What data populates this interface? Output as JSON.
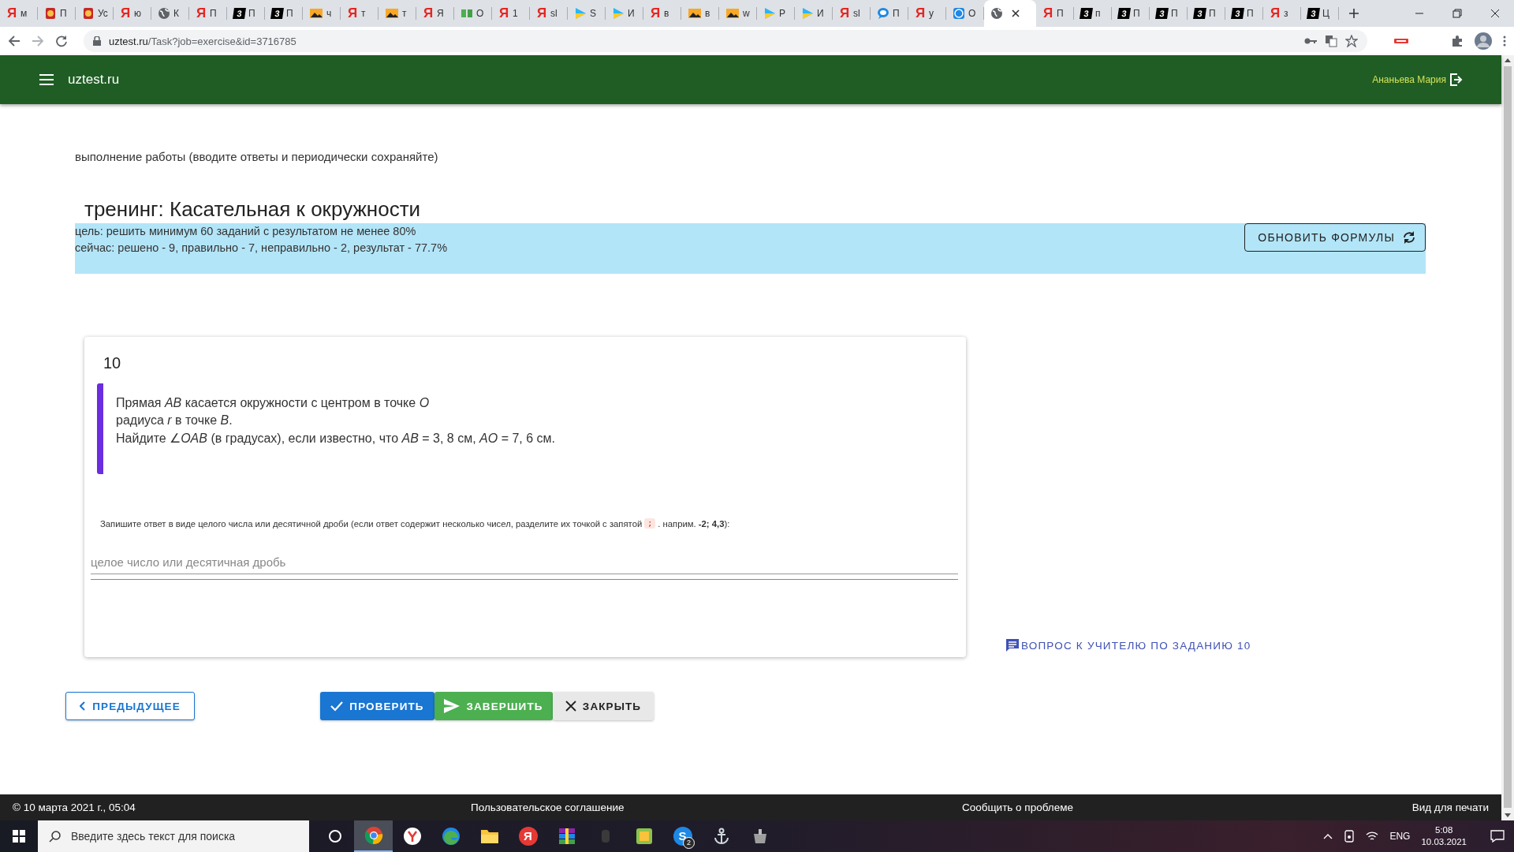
{
  "browser": {
    "tabs": [
      {
        "kind": "letter",
        "glyph": "Я",
        "title": "м",
        "selected": false
      },
      {
        "kind": "emblem",
        "title": "П",
        "selected": false
      },
      {
        "kind": "emblem",
        "title": "Ус",
        "selected": false
      },
      {
        "kind": "letter",
        "glyph": "Я",
        "title": "ю",
        "selected": false
      },
      {
        "kind": "globe",
        "title": "К",
        "selected": false
      },
      {
        "kind": "letter",
        "glyph": "Я",
        "title": "П",
        "selected": false
      },
      {
        "kind": "badge",
        "glyph": "3",
        "title": "П",
        "selected": false
      },
      {
        "kind": "badge",
        "glyph": "3",
        "title": "П",
        "selected": false
      },
      {
        "kind": "image",
        "title": "ч",
        "selected": false
      },
      {
        "kind": "letter",
        "glyph": "Я",
        "title": "т",
        "selected": false
      },
      {
        "kind": "image",
        "title": "т",
        "selected": false
      },
      {
        "kind": "letter",
        "glyph": "Я",
        "title": "Я",
        "selected": false
      },
      {
        "kind": "book",
        "title": "О",
        "selected": false
      },
      {
        "kind": "letter",
        "glyph": "Я",
        "title": "1",
        "selected": false
      },
      {
        "kind": "letter",
        "glyph": "Я",
        "title": "sl",
        "selected": false
      },
      {
        "kind": "play",
        "title": "S",
        "selected": false
      },
      {
        "kind": "play",
        "title": "И",
        "selected": false
      },
      {
        "kind": "letter",
        "glyph": "Я",
        "title": "в",
        "selected": false
      },
      {
        "kind": "image",
        "title": "в",
        "selected": false
      },
      {
        "kind": "image",
        "title": "w",
        "selected": false
      },
      {
        "kind": "play",
        "title": "Р",
        "selected": false
      },
      {
        "kind": "play",
        "title": "И",
        "selected": false
      },
      {
        "kind": "letter",
        "glyph": "Я",
        "title": "sl",
        "selected": false
      },
      {
        "kind": "chat",
        "title": "П",
        "selected": false
      },
      {
        "kind": "letter",
        "glyph": "Я",
        "title": "у",
        "selected": false
      },
      {
        "kind": "help",
        "title": "О",
        "selected": false
      },
      {
        "kind": "globe",
        "selected": true
      },
      {
        "kind": "letter",
        "glyph": "Я",
        "title": "П",
        "selected": false
      },
      {
        "kind": "badge",
        "glyph": "3",
        "title": "п",
        "selected": false
      },
      {
        "kind": "badge",
        "glyph": "3",
        "title": "П",
        "selected": false
      },
      {
        "kind": "badge",
        "glyph": "3",
        "title": "П",
        "selected": false
      },
      {
        "kind": "badge",
        "glyph": "3",
        "title": "П",
        "selected": false
      },
      {
        "kind": "badge",
        "glyph": "3",
        "title": "П",
        "selected": false
      },
      {
        "kind": "letter",
        "glyph": "Я",
        "title": "з",
        "selected": false
      },
      {
        "kind": "badge",
        "glyph": "3",
        "title": "Ц",
        "selected": false
      }
    ],
    "url_host": "uztest.ru",
    "url_path": "/Task?job=exercise&id=3716785"
  },
  "header": {
    "site": "uztest.ru",
    "user": "Ананьева Мария"
  },
  "page": {
    "mode_note": "выполнение работы (вводите ответы и периодически сохраняйте)",
    "title": "тренинг: Касательная к окружности",
    "goal": "цель: решить минимум 60 заданий с результатом не менее 80%",
    "progress": "сейчас: решено - 9, правильно - 7, неправильно - 2, результат - 77.7%",
    "refresh_button": "ОБНОВИТЬ ФОРМУЛЫ"
  },
  "task": {
    "number": "10",
    "statement": [
      "Прямая *AB* касается окружности с центром в точке *O*",
      "радиуса *r* в точке *B*.",
      "Найдите ∠*OAB* (в градусах), если известно, что *AB* = 3, 8 см, *AO* = 7, 6 см."
    ],
    "hint_before": "Запишите ответ в виде целого числа или десятичной дроби (если ответ содержит несколько чисел, разделите их точкой с запятой",
    "hint_code": ";",
    "hint_after": ". наприм. **-2; 4,3**):",
    "answer": {
      "placeholder": "целое число или десятичная дробь"
    }
  },
  "ask_teacher": "ВОПРОС К УЧИТЕЛЮ ПО ЗАДАНИЮ 10",
  "buttons": [
    {
      "kind": "outline",
      "label": "ПРЕДЫДУЩЕЕ"
    },
    {
      "kind": "primary",
      "label": "ПРОВЕРИТЬ"
    },
    {
      "kind": "success",
      "label": "ЗАВЕРШИТЬ"
    },
    {
      "kind": "plain",
      "label": "ЗАКРЫТЬ"
    }
  ],
  "footer": {
    "copyright": "© 10 марта 2021 г., 05:04",
    "links": [
      "Пользовательское соглашение",
      "Сообщить о проблеме",
      "Вид для печати"
    ]
  },
  "taskbar": {
    "search_placeholder": "Введите здесь текст для поиска",
    "apps": [
      {
        "kind": "cortana",
        "selected": false
      },
      {
        "kind": "chrome",
        "selected": true
      },
      {
        "kind": "ybrowser",
        "selected": false
      },
      {
        "kind": "edge",
        "selected": false
      },
      {
        "kind": "folder",
        "selected": false
      },
      {
        "kind": "letter",
        "glyph": "Я",
        "selected": false
      },
      {
        "kind": "archive",
        "selected": false
      },
      {
        "kind": "blank",
        "selected": false
      },
      {
        "kind": "green",
        "selected": false
      },
      {
        "kind": "letter2",
        "glyph": "S",
        "badge": "2",
        "selected": false
      },
      {
        "kind": "anchor",
        "selected": false
      },
      {
        "kind": "tank",
        "selected": false
      }
    ],
    "language": "ENG",
    "time": "5:08",
    "date": "10.03.2021"
  }
}
